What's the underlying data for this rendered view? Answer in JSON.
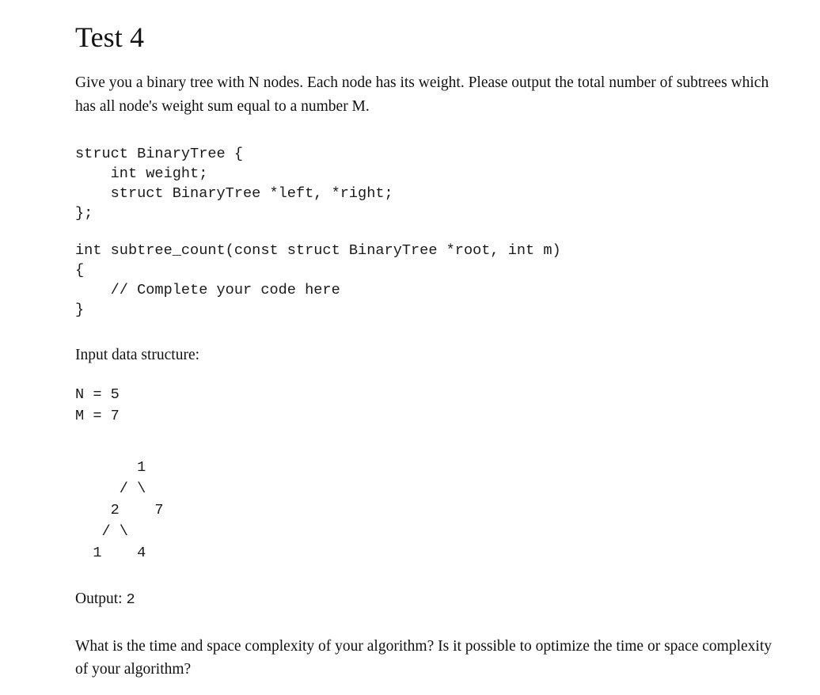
{
  "document": {
    "title": "Test 4",
    "problem_statement": "Give you a binary tree with N nodes. Each node has its weight. Please output the total number of subtrees which has all node's weight sum equal to a number M.",
    "struct_code": "struct BinaryTree {\n    int weight;\n    struct BinaryTree *left, *right;\n};",
    "function_code": "int subtree_count(const struct BinaryTree *root, int m)\n{\n    // Complete your code here\n}",
    "input_section_label": "Input data structure:",
    "input_n_line": "N = 5",
    "input_m_line": "M = 7",
    "tree_art": "       1\n     / \\\n    2    7\n   / \\\n  1    4",
    "output_label": "Output:",
    "output_value": "2",
    "followup_question": "What is the time and space complexity of your algorithm? Is it possible to optimize the time or space complexity of your algorithm?"
  }
}
